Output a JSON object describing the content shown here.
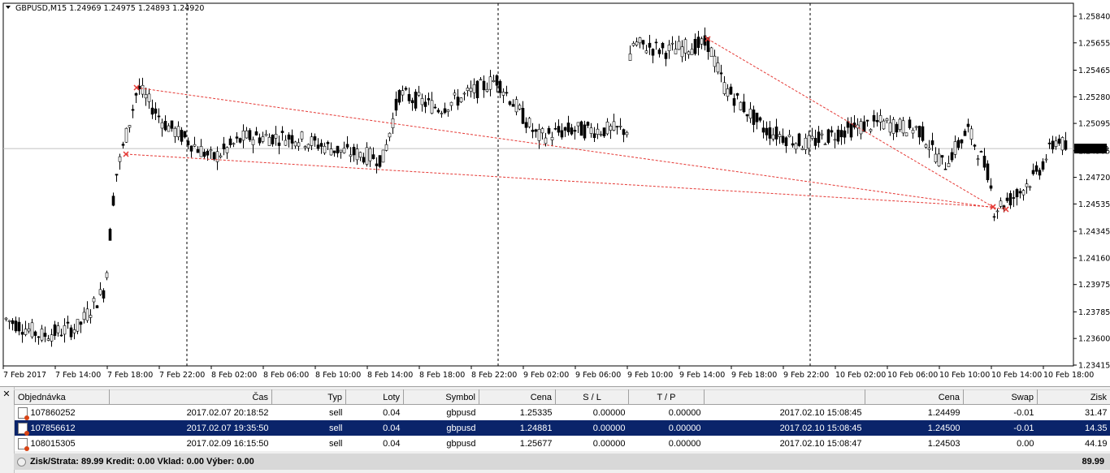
{
  "chart": {
    "header_symbol": "GBPUSD,M15",
    "header_ohlc": "1.24969 1.24975 1.24893 1.24920",
    "current_price": "1.24920",
    "price_scale": [
      "1.25840",
      "1.25655",
      "1.25465",
      "1.25280",
      "1.25095",
      "1.24905",
      "1.24720",
      "1.24535",
      "1.24345",
      "1.24160",
      "1.23975",
      "1.23785",
      "1.23600",
      "1.23415"
    ],
    "time_labels": [
      "7 Feb 2017",
      "7 Feb 14:00",
      "7 Feb 18:00",
      "7 Feb 22:00",
      "8 Feb 02:00",
      "8 Feb 06:00",
      "8 Feb 10:00",
      "8 Feb 14:00",
      "8 Feb 18:00",
      "8 Feb 22:00",
      "9 Feb 02:00",
      "9 Feb 06:00",
      "9 Feb 10:00",
      "9 Feb 14:00",
      "9 Feb 18:00",
      "9 Feb 22:00",
      "10 Feb 02:00",
      "10 Feb 06:00",
      "10 Feb 10:00",
      "10 Feb 14:00",
      "10 Feb 18:00"
    ],
    "colors": {
      "candle": "#000000",
      "trade_line": "#e53935",
      "grid": "#000000",
      "current_line": "#c0c0c0"
    }
  },
  "terminal": {
    "close_icon": "close-icon",
    "columns": [
      "Objednávka",
      "Čas",
      "Typ",
      "Loty",
      "Symbol",
      "Cena",
      "S / L",
      "T / P",
      "",
      "Cena",
      "Swap",
      "Zisk"
    ],
    "rows": [
      {
        "order": "107860252",
        "time": "2017.02.07 20:18:52",
        "type": "sell",
        "lots": "0.04",
        "symbol": "gbpusd",
        "price": "1.25335",
        "sl": "0.00000",
        "tp": "0.00000",
        "close_time": "2017.02.10 15:08:45",
        "close_price": "1.24499",
        "swap": "-0.01",
        "profit": "31.47"
      },
      {
        "order": "107856612",
        "time": "2017.02.07 19:35:50",
        "type": "sell",
        "lots": "0.04",
        "symbol": "gbpusd",
        "price": "1.24881",
        "sl": "0.00000",
        "tp": "0.00000",
        "close_time": "2017.02.10 15:08:45",
        "close_price": "1.24500",
        "swap": "-0.01",
        "profit": "14.35"
      },
      {
        "order": "108015305",
        "time": "2017.02.09 16:15:50",
        "type": "sell",
        "lots": "0.04",
        "symbol": "gbpusd",
        "price": "1.25677",
        "sl": "0.00000",
        "tp": "0.00000",
        "close_time": "2017.02.10 15:08:47",
        "close_price": "1.24503",
        "swap": "0.00",
        "profit": "44.19"
      }
    ],
    "summary_text": "Zisk/Strata: 89.99  Kredit: 0.00  Vklad: 0.00  Výber: 0.00",
    "summary_total": "89.99"
  }
}
